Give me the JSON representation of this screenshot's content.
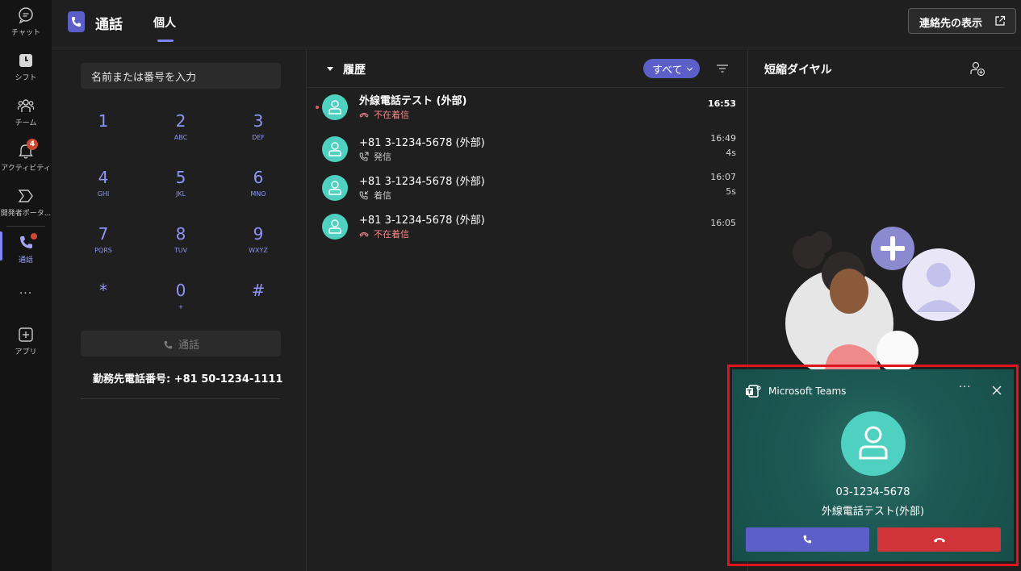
{
  "rail": {
    "items": [
      {
        "label": "チャット",
        "icon": "chat-icon"
      },
      {
        "label": "シフト",
        "icon": "shifts-icon"
      },
      {
        "label": "チーム",
        "icon": "teams-icon"
      },
      {
        "label": "アクティビティ",
        "icon": "bell-icon",
        "badge": "4"
      },
      {
        "label": "開発者ポータ...",
        "icon": "dev-portal-icon"
      },
      {
        "label": "通話",
        "icon": "phone-icon",
        "active": true
      },
      {
        "label": "...",
        "icon": "more-icon"
      },
      {
        "label": "アプリ",
        "icon": "apps-icon"
      }
    ]
  },
  "header": {
    "title": "通話",
    "tab": "個人",
    "contacts_button": "連絡先の表示"
  },
  "dialpad": {
    "placeholder": "名前または番号を入力",
    "keys": [
      {
        "digit": "1",
        "letters": ""
      },
      {
        "digit": "2",
        "letters": "ABC"
      },
      {
        "digit": "3",
        "letters": "DEF"
      },
      {
        "digit": "4",
        "letters": "GHI"
      },
      {
        "digit": "5",
        "letters": "JKL"
      },
      {
        "digit": "6",
        "letters": "MNO"
      },
      {
        "digit": "7",
        "letters": "PQRS"
      },
      {
        "digit": "8",
        "letters": "TUV"
      },
      {
        "digit": "9",
        "letters": "WXYZ"
      },
      {
        "digit": "*",
        "letters": ""
      },
      {
        "digit": "0",
        "letters": "+"
      },
      {
        "digit": "#",
        "letters": ""
      }
    ],
    "call_label": "通話",
    "work_number": "勤務先電話番号: +81 50-1234-1111"
  },
  "history": {
    "title": "履歴",
    "filter": "すべて",
    "rows": [
      {
        "name": "外線電話テスト (外部)",
        "status": "不在着信",
        "type": "missed",
        "time": "16:53",
        "duration": "",
        "unread": true
      },
      {
        "name": "+81 3-1234-5678 (外部)",
        "status": "発信",
        "type": "outgoing",
        "time": "16:49",
        "duration": "4s",
        "unread": false
      },
      {
        "name": "+81 3-1234-5678 (外部)",
        "status": "着信",
        "type": "incoming",
        "time": "16:07",
        "duration": "5s",
        "unread": false
      },
      {
        "name": "+81 3-1234-5678 (外部)",
        "status": "不在着信",
        "type": "missed",
        "time": "16:05",
        "duration": "",
        "unread": false
      }
    ]
  },
  "speed_dial": {
    "title": "短縮ダイヤル"
  },
  "toast": {
    "app_name": "Microsoft Teams",
    "more": "···",
    "caller_number": "03-1234-5678",
    "caller_name": "外線電話テスト(外部)"
  },
  "colors": {
    "accent": "#5b5fc7",
    "avatar": "#4fd1c2",
    "missed": "#f08a8a",
    "decline": "#d13438",
    "highlight_frame": "#e0141e"
  }
}
